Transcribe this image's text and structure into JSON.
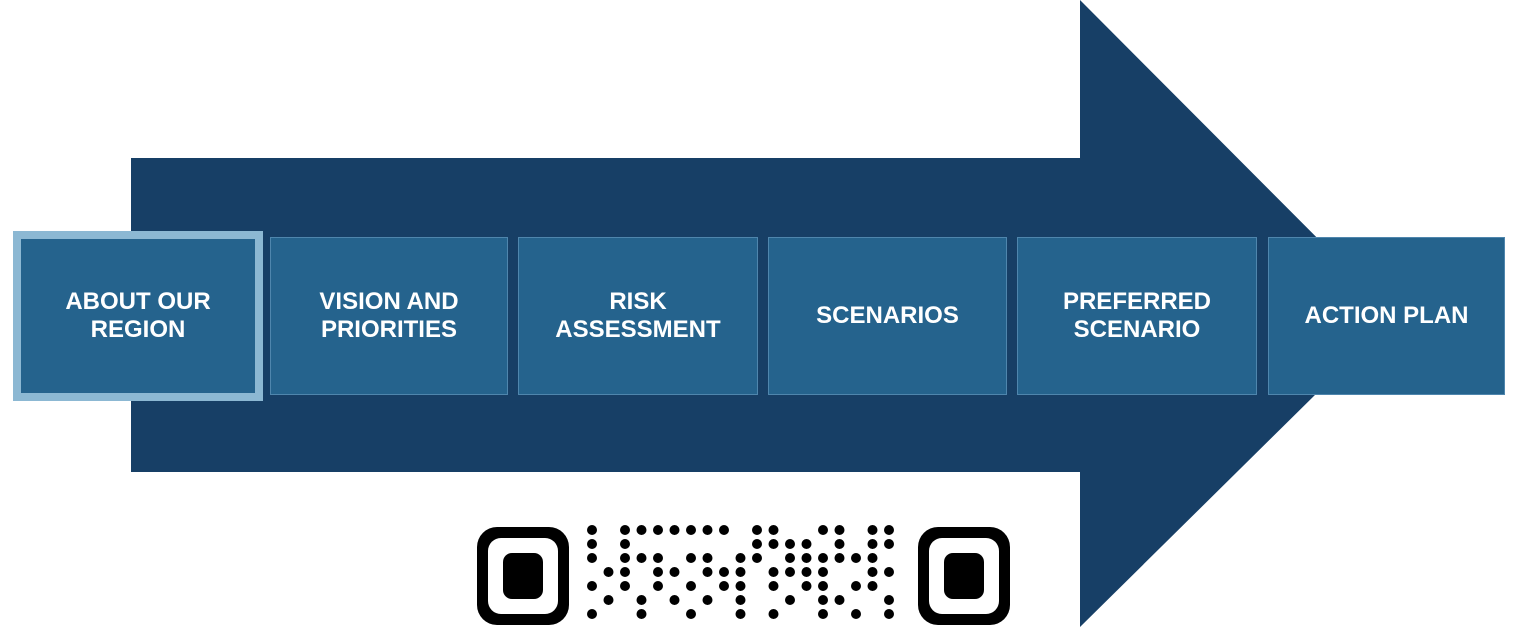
{
  "diagram": {
    "arrow_color": "#173f66",
    "step_color": "#25638d",
    "active_border_color": "#8cb8d3",
    "steps": [
      {
        "label": "ABOUT OUR REGION",
        "active": true
      },
      {
        "label": "VISION AND PRIORITIES",
        "active": false
      },
      {
        "label": "RISK ASSESSMENT",
        "active": false
      },
      {
        "label": "SCENARIOS",
        "active": false
      },
      {
        "label": "PREFERRED SCENARIO",
        "active": false
      },
      {
        "label": "ACTION PLAN",
        "active": false
      }
    ]
  },
  "qr": {
    "icon": "qr-code-icon"
  }
}
